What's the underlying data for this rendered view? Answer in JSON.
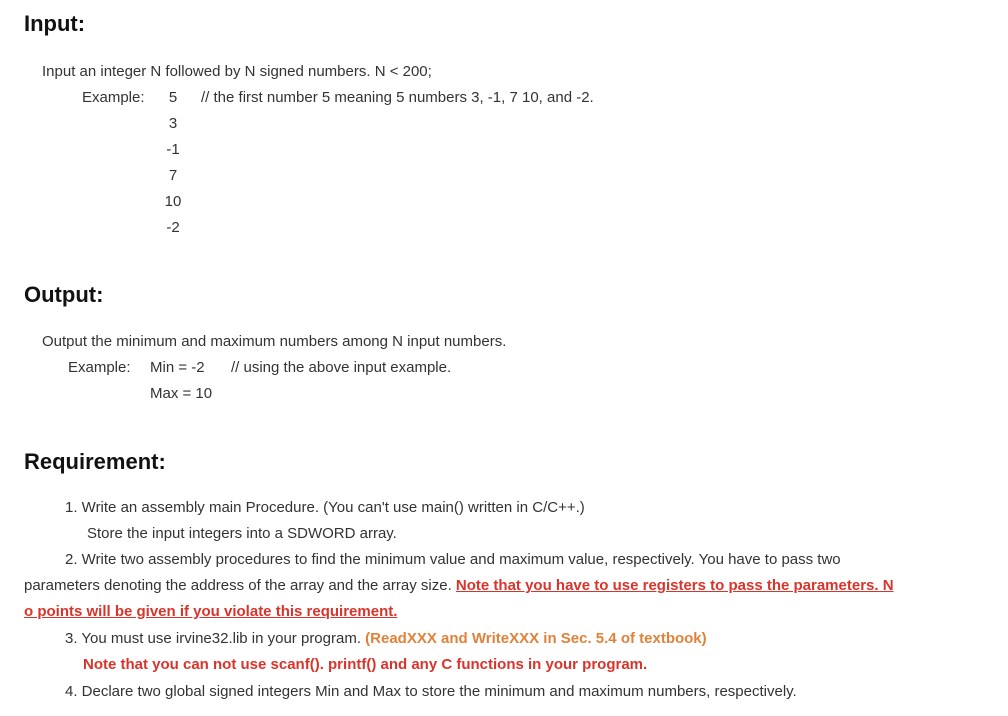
{
  "input": {
    "heading": "Input:",
    "desc": "Input an integer N followed by N signed  numbers.  N < 200;",
    "example_label": "Example:",
    "numbers": [
      "5",
      "3",
      "-1",
      "7",
      "10",
      "-2"
    ],
    "comment": "// the first number 5 meaning 5 numbers 3, -1, 7 10, and -2."
  },
  "output": {
    "heading": "Output:",
    "desc": "Output the minimum and maximum numbers among N input numbers.",
    "example_label": "Example:",
    "min_line": "Min = -2",
    "comment": "// using the above input example.",
    "max_line": "Max = 10"
  },
  "requirement": {
    "heading": "Requirement:",
    "r1_line1": "1.  Write an assembly main Procedure.  (You can't use main() written in C/C++.)",
    "r1_line2": "Store the input integers into a SDWORD array.",
    "r2_line1": "2. Write two assembly procedures to find the minimum value and maximum value, respectively. You have to pass two",
    "r2_line2_plain": "parameters denoting the address of the array and the array size. ",
    "r2_line2_red": "Note that you have to use registers to pass the parameters. N",
    "r2_line3_red": "o points will be given if you violate this requirement.",
    "r3_line1_plain": "3. You must use irvine32.lib in your program.  ",
    "r3_line1_orange": "(ReadXXX and WriteXXX in Sec. 5.4 of textbook)",
    "r3_line2_red": "Note that you can not use scanf(). printf()  and any C functions in your program.",
    "r4_line1": "4. Declare two global signed integers Min and Max to store the minimum and maximum numbers, respectively."
  }
}
